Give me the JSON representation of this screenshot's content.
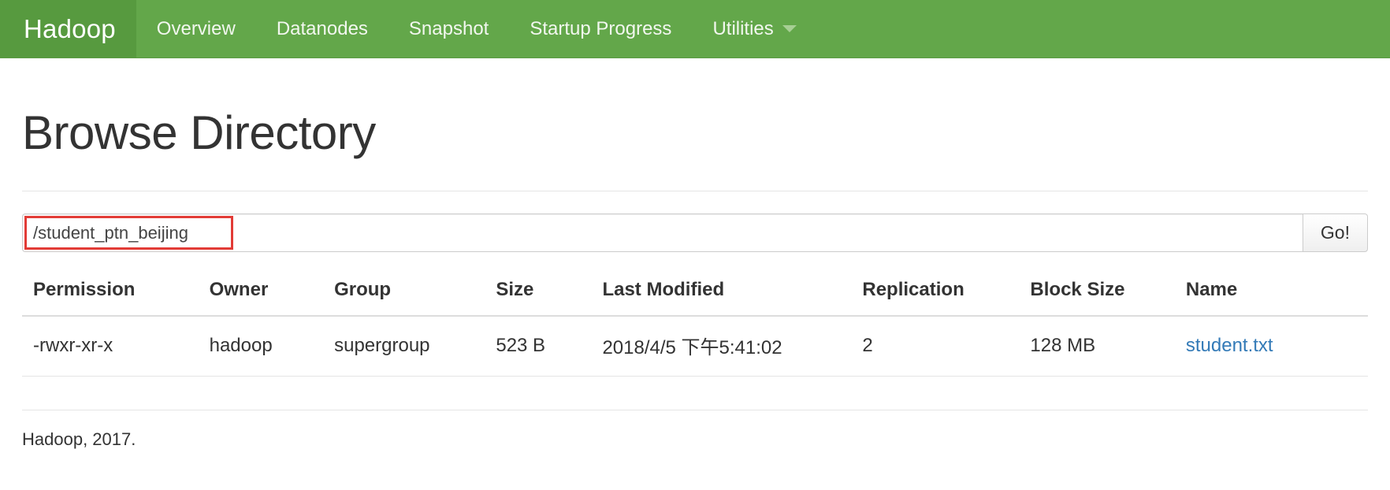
{
  "navbar": {
    "brand": "Hadoop",
    "items": [
      {
        "label": "Overview",
        "has_caret": false
      },
      {
        "label": "Datanodes",
        "has_caret": false
      },
      {
        "label": "Snapshot",
        "has_caret": false
      },
      {
        "label": "Startup Progress",
        "has_caret": false
      },
      {
        "label": "Utilities",
        "has_caret": true
      }
    ],
    "background_color": "#63a74a",
    "brand_background_color": "#579a3f"
  },
  "page": {
    "title": "Browse Directory"
  },
  "path_bar": {
    "value": "/student_ptn_beijing",
    "placeholder": "/",
    "go_label": "Go!",
    "annotation_color": "#e23b36"
  },
  "table": {
    "headers": [
      "Permission",
      "Owner",
      "Group",
      "Size",
      "Last Modified",
      "Replication",
      "Block Size",
      "Name"
    ],
    "rows": [
      {
        "permission": "-rwxr-xr-x",
        "owner": "hadoop",
        "group": "supergroup",
        "size": "523 B",
        "last_modified": "2018/4/5 下午5:41:02",
        "replication": "2",
        "block_size": "128 MB",
        "name": "student.txt",
        "name_link_color": "#337ab7"
      }
    ]
  },
  "footer": {
    "text": "Hadoop, 2017."
  }
}
